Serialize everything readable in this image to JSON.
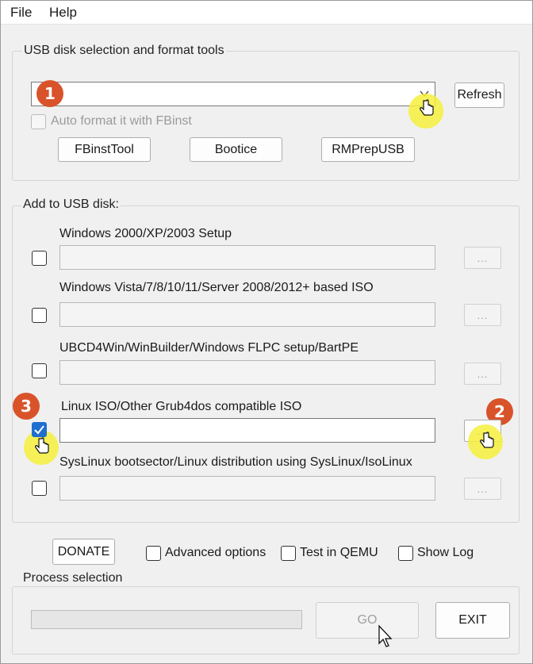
{
  "menu": {
    "file": "File",
    "help": "Help"
  },
  "usb_group": {
    "title": "USB disk selection and format tools",
    "disk_value": "",
    "refresh": "Refresh",
    "auto_format": "Auto format it with FBinst",
    "tools": [
      "FBinstTool",
      "Bootice",
      "RMPrepUSB"
    ]
  },
  "add_group": {
    "title": "Add to USB disk:",
    "sections": [
      {
        "label": "Windows 2000/XP/2003 Setup",
        "checked": false,
        "browse": "..."
      },
      {
        "label": "Windows Vista/7/8/10/11/Server 2008/2012+ based ISO",
        "checked": false,
        "browse": "..."
      },
      {
        "label": "UBCD4Win/WinBuilder/Windows FLPC setup/BartPE",
        "checked": false,
        "browse": "..."
      },
      {
        "label": "Linux ISO/Other Grub4dos compatible ISO",
        "checked": true,
        "browse": "..."
      },
      {
        "label": "SysLinux bootsector/Linux distribution using SysLinux/IsoLinux",
        "checked": false,
        "browse": "..."
      }
    ]
  },
  "options": {
    "donate": "DONATE",
    "advanced": "Advanced options",
    "qemu": "Test in QEMU",
    "showlog": "Show Log"
  },
  "process": {
    "title": "Process selection",
    "progress": 0,
    "go": "GO",
    "exit": "EXIT"
  },
  "annotations": {
    "step1": "1",
    "step2": "2",
    "step3": "3"
  },
  "colors": {
    "badge": "#d9532a",
    "highlight": "#f6f03c",
    "checkbox_checked": "#1f6fd0"
  }
}
